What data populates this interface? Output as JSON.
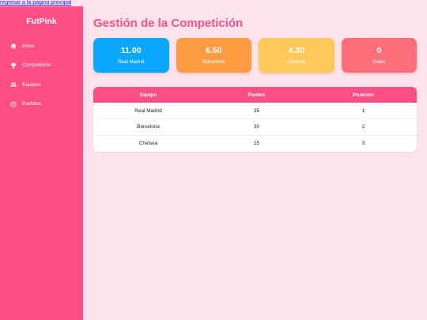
{
  "top_link": "regresar a la pagina principal",
  "sidebar": {
    "brand": "FutPink",
    "items": [
      {
        "label": "Inicio",
        "icon": "home-icon"
      },
      {
        "label": "Competición",
        "icon": "trophy-icon"
      },
      {
        "label": "Equipos",
        "icon": "users-icon"
      },
      {
        "label": "Partidos",
        "icon": "soccer-ball-icon"
      }
    ]
  },
  "main": {
    "title": "Gestión de la Competición",
    "cards": [
      {
        "value": "11.00",
        "label": "Real Madrid",
        "color": "#0aa7ff"
      },
      {
        "value": "6.50",
        "label": "Barcelona",
        "color": "#ff9d45"
      },
      {
        "value": "4.30",
        "label": "Chelsea",
        "color": "#ffc95a"
      },
      {
        "value": "0",
        "label": "Goles",
        "color": "#ff6e7a"
      }
    ],
    "table": {
      "headers": [
        "Equipo",
        "Puntos",
        "Posición"
      ],
      "rows": [
        [
          "Real Madrid",
          "35",
          "1"
        ],
        [
          "Barcelona",
          "30",
          "2"
        ],
        [
          "Chelsea",
          "25",
          "3"
        ]
      ]
    }
  },
  "colors": {
    "accent": "#ff4f85",
    "background": "#ffe3ec"
  }
}
